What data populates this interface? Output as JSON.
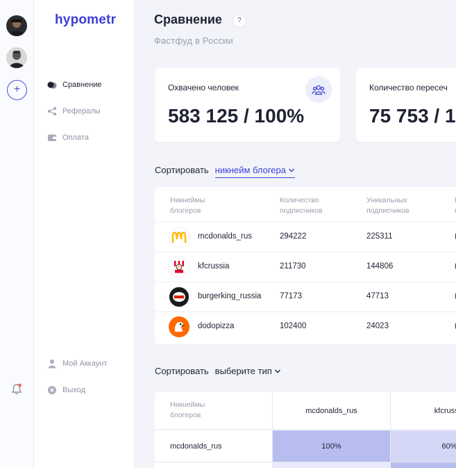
{
  "app": {
    "logo": "hypometr",
    "add_symbol": "+"
  },
  "sidebar": {
    "items": [
      {
        "label": "Сравнение",
        "icon": "compare-icon",
        "active": true
      },
      {
        "label": "Рефералы",
        "icon": "share-icon",
        "active": false
      },
      {
        "label": "Оплата",
        "icon": "wallet-icon",
        "active": false
      }
    ],
    "bottom_items": [
      {
        "label": "Мой Аккаунт",
        "icon": "user-icon"
      },
      {
        "label": "Выход",
        "icon": "close-circle-icon"
      }
    ]
  },
  "header": {
    "title": "Сравнение",
    "help": "?",
    "subtitle": "Фастфуд в России"
  },
  "stats": [
    {
      "label": "Охвачено человек",
      "value": "583 125 / 100%",
      "icon": "people-icon"
    },
    {
      "label": "Количество пересеч",
      "value": "75 753 / 1"
    }
  ],
  "sort1": {
    "label": "Сортировать",
    "value": "никнейм блогера"
  },
  "table": {
    "headers": [
      "Никнеймы\nблогеров",
      "Количество\nподписчиков",
      "Уникальных\nподписчиков",
      "П\nп"
    ],
    "rows": [
      {
        "name": "mcdonalds_rus",
        "subscribers": "294222",
        "unique": "225311",
        "extra": "(",
        "logo": "mcdonalds-logo"
      },
      {
        "name": "kfcrussia",
        "subscribers": "211730",
        "unique": "144806",
        "extra": "(",
        "logo": "kfc-logo"
      },
      {
        "name": "burgerking_russia",
        "subscribers": "77173",
        "unique": "47713",
        "extra": "(",
        "logo": "burgerking-logo"
      },
      {
        "name": "dodopizza",
        "subscribers": "102400",
        "unique": "24023",
        "extra": "(",
        "logo": "dodo-logo"
      }
    ]
  },
  "sort2": {
    "label": "Сортировать",
    "value": "выберите тип"
  },
  "matrix": {
    "corner": "Никнеймы\nблогеров",
    "columns": [
      "mcdonalds_rus",
      "kfcrussia"
    ],
    "rows": [
      {
        "name": "mcdonalds_rus",
        "cells": [
          "100%",
          "60%"
        ]
      }
    ],
    "colors": {
      "strong": "#b8bdf0",
      "medium": "#d4d7f6",
      "light": "#e8eafb"
    }
  },
  "colors": {
    "accent": "#3b3fd8",
    "notification": "#f26b4a"
  }
}
